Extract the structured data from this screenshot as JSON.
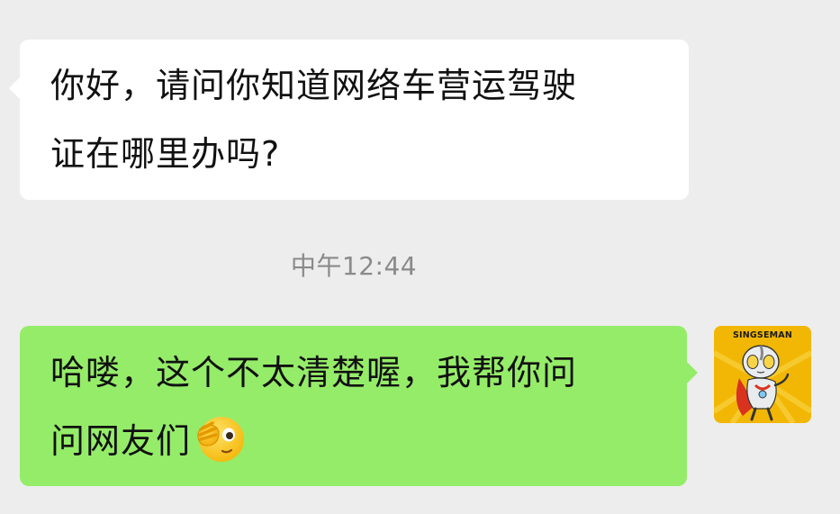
{
  "conversation": {
    "incoming": {
      "lines": [
        "你好，请问你知道网络车营运驾驶",
        "证在哪里办吗?"
      ]
    },
    "timestamp": "中午12:44",
    "outgoing": {
      "lines": [
        "哈喽，这个不太清楚喔，我帮你问",
        "问网友们"
      ],
      "emoji": "face-with-hand-over-eye-emoji"
    },
    "avatar": {
      "label": "SINGSEMAN",
      "icon": "cartoon-hero-avatar-icon"
    }
  },
  "colors": {
    "background": "#ededed",
    "incoming_bubble": "#ffffff",
    "outgoing_bubble": "#95ec69",
    "timestamp_text": "#8a8a8a",
    "avatar_background": "#f2b705"
  }
}
